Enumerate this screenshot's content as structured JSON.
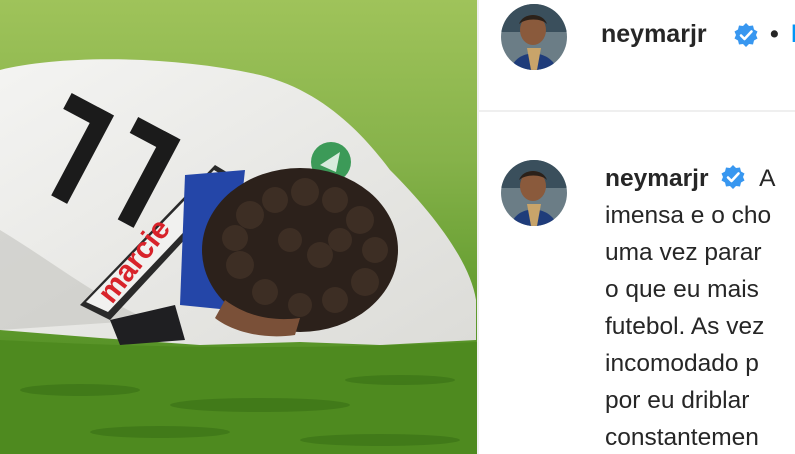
{
  "post": {
    "photo_icon": "player-lying-on-grass-photo",
    "jersey_number": "11",
    "jersey_sponsor": "marcie"
  },
  "header": {
    "username": "neymarjr",
    "verified_icon": "verified-badge-icon",
    "separator": "•",
    "follow_label": "F"
  },
  "caption": {
    "username": "neymarjr",
    "lines": [
      "A",
      "imensa e o cho",
      "uma vez parar",
      "o que eu mais",
      "futebol. As vez",
      "incomodado p",
      "por eu driblar",
      "constantemen"
    ]
  },
  "colors": {
    "accent": "#0095f6",
    "text": "#262626",
    "divider": "#efefef",
    "grass": "#4e8a1f"
  }
}
